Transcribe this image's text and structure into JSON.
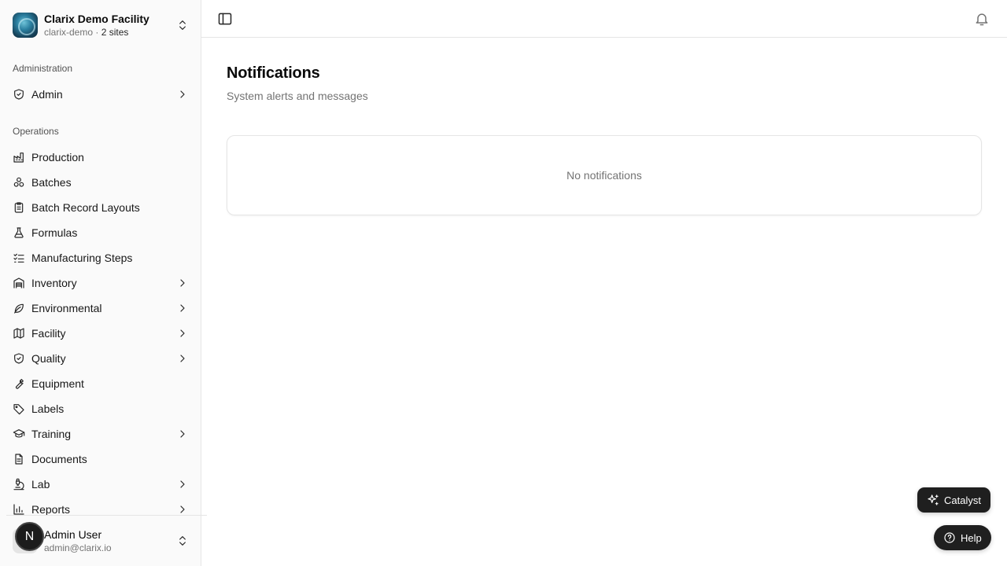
{
  "org": {
    "name": "Clarix Demo Facility",
    "slug": "clarix-demo",
    "sites": "2 sites"
  },
  "groups": {
    "administration": "Administration",
    "operations": "Operations"
  },
  "nav": {
    "admin": "Admin",
    "production": "Production",
    "batches": "Batches",
    "batch_record_layouts": "Batch Record Layouts",
    "formulas": "Formulas",
    "manufacturing_steps": "Manufacturing Steps",
    "inventory": "Inventory",
    "environmental": "Environmental",
    "facility": "Facility",
    "quality": "Quality",
    "equipment": "Equipment",
    "labels": "Labels",
    "training": "Training",
    "documents": "Documents",
    "lab": "Lab",
    "reports": "Reports"
  },
  "user": {
    "name": "Admin User",
    "email": "admin@clarix.io",
    "badge": "N"
  },
  "page": {
    "title": "Notifications",
    "subtitle": "System alerts and messages",
    "empty": "No notifications"
  },
  "buttons": {
    "catalyst": "Catalyst",
    "help": "Help"
  }
}
